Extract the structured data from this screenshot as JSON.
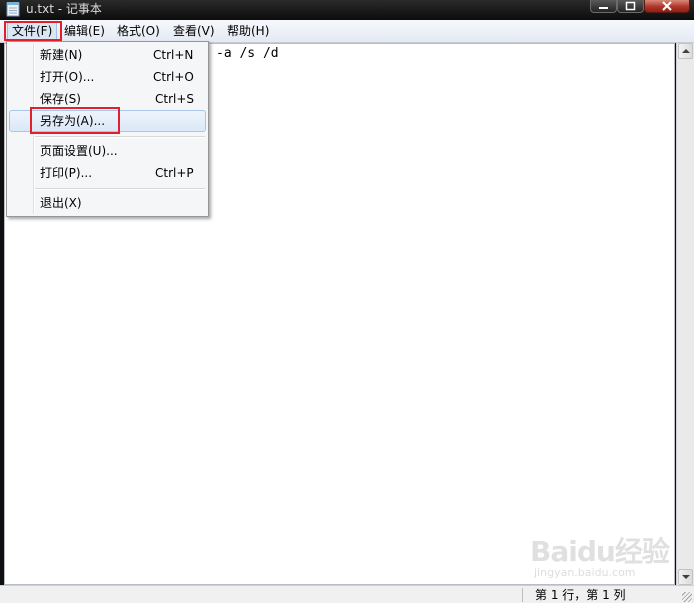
{
  "window": {
    "title": "u.txt - 记事本",
    "icon": "notepad-icon"
  },
  "menubar": {
    "file": "文件(F)",
    "edit": "编辑(E)",
    "format": "格式(O)",
    "view": "查看(V)",
    "help": "帮助(H)"
  },
  "file_menu": {
    "items": [
      {
        "label": "新建(N)",
        "shortcut": "Ctrl+N"
      },
      {
        "label": "打开(O)...",
        "shortcut": "Ctrl+O"
      },
      {
        "label": "保存(S)",
        "shortcut": "Ctrl+S"
      },
      {
        "label": "另存为(A)...",
        "shortcut": ""
      },
      {
        "label": "页面设置(U)...",
        "shortcut": ""
      },
      {
        "label": "打印(P)...",
        "shortcut": "Ctrl+P"
      },
      {
        "label": "退出(X)",
        "shortcut": ""
      }
    ],
    "highlighted": "另存为(A)..."
  },
  "editor": {
    "visible_text": "-a /s /d"
  },
  "statusbar": {
    "position": "第 1 行，第 1 列"
  },
  "watermark": {
    "logo": "Baidu",
    "logo_suffix": "经验",
    "url": "jingyan.baidu.com"
  },
  "colors": {
    "annotation_red": "#e0202a",
    "menu_hover_bg": "#dbe8f8",
    "menu_hover_border": "#a9c6ea"
  }
}
